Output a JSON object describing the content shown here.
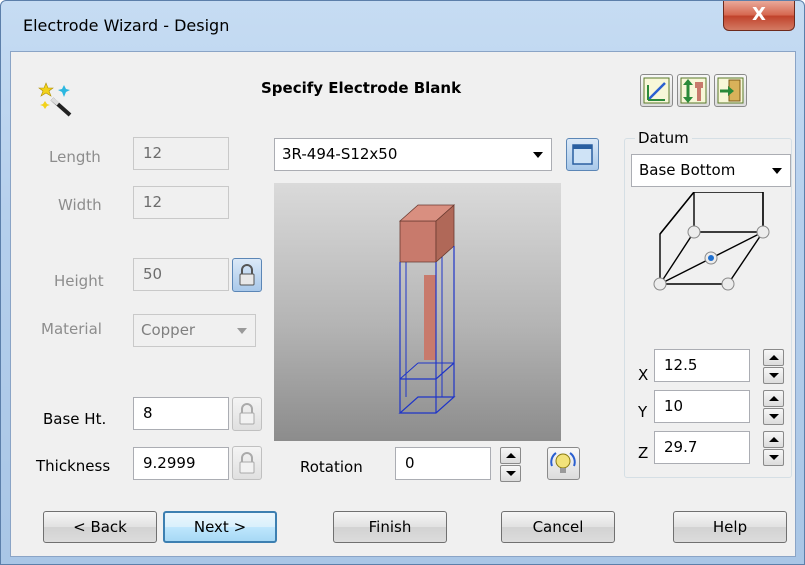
{
  "window": {
    "title": "Electrode Wizard - Design",
    "close_glyph": "X"
  },
  "header": {
    "heading": "Specify Electrode Blank",
    "wizard_icon": "magic-wand-icon"
  },
  "toolbar": {
    "icons": [
      "measure-icon",
      "height-adjust-icon",
      "exit-icon"
    ]
  },
  "dimensions": {
    "length_label": "Length",
    "length_value": "12",
    "width_label": "Width",
    "width_value": "12",
    "height_label": "Height",
    "height_value": "50",
    "material_label": "Material",
    "material_value": "Copper"
  },
  "base": {
    "base_ht_label": "Base Ht.",
    "base_ht_value": "8",
    "thickness_label": "Thickness",
    "thickness_value": "9.2999"
  },
  "blank": {
    "selected": "3R-494-S12x50"
  },
  "rotation": {
    "label": "Rotation",
    "value": "0"
  },
  "datum": {
    "label": "Datum",
    "selected": "Base Bottom",
    "x_label": "X",
    "x_value": "12.5",
    "y_label": "Y",
    "y_value": "10",
    "z_label": "Z",
    "z_value": "29.7"
  },
  "buttons": {
    "back": "< Back",
    "next": "Next >",
    "finish": "Finish",
    "cancel": "Cancel",
    "help": "Help"
  },
  "colors": {
    "blank_fill": "#c87a6c",
    "wire": "#1f35c8",
    "accent": "#3c7fb1"
  }
}
